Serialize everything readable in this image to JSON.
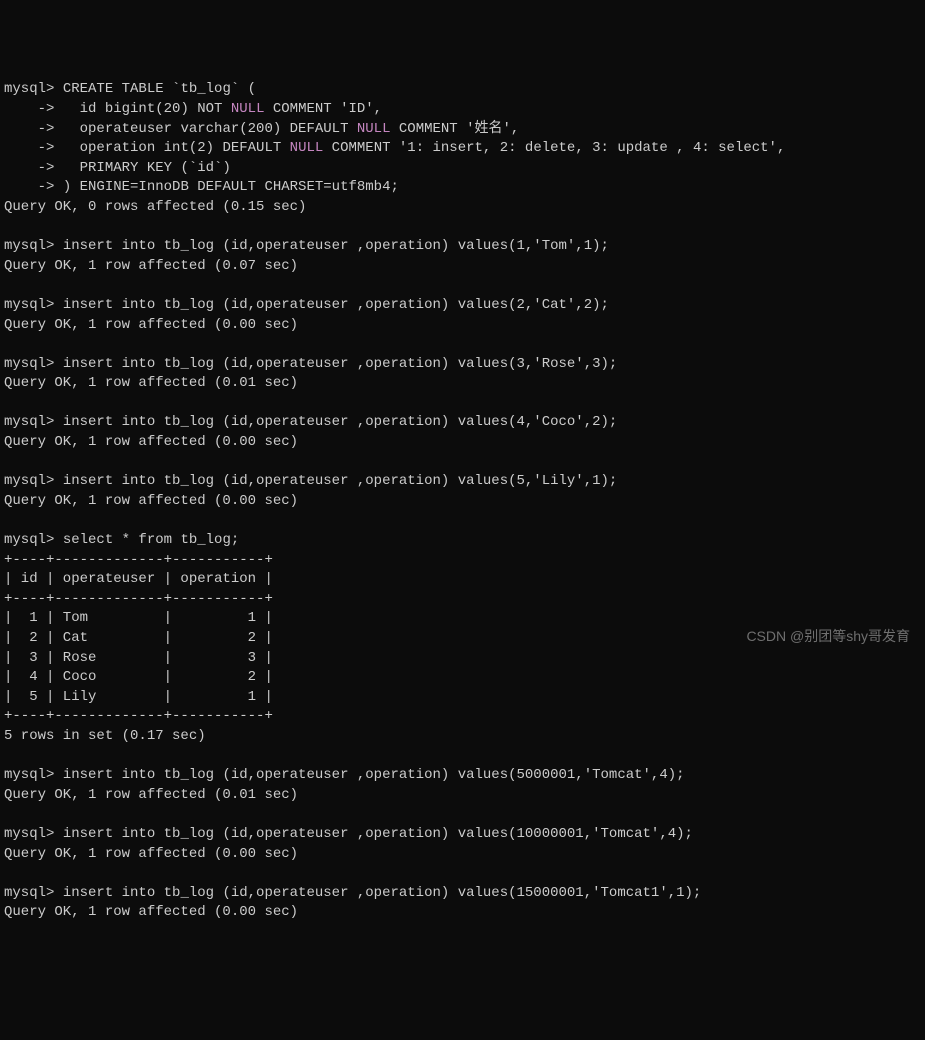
{
  "lines": [
    {
      "prompt": "mysql>",
      "text": " CREATE TABLE `tb_log` ("
    },
    {
      "prompt": "    ->",
      "text": "   id bigint(20) NOT ",
      "null": "NULL",
      "after": " COMMENT 'ID',"
    },
    {
      "prompt": "    ->",
      "text": "   operateuser varchar(200) DEFAULT ",
      "null": "NULL",
      "after": " COMMENT '姓名',"
    },
    {
      "prompt": "    ->",
      "text": "   operation int(2) DEFAULT ",
      "null": "NULL",
      "after": " COMMENT '1: insert, 2: delete, 3: update , 4: select',"
    },
    {
      "prompt": "    ->",
      "text": "   PRIMARY KEY (`id`)"
    },
    {
      "prompt": "    ->",
      "text": " ) ENGINE=InnoDB DEFAULT CHARSET=utf8mb4;"
    },
    {
      "text": "Query OK, 0 rows affected (0.15 sec)"
    },
    {
      "text": ""
    },
    {
      "prompt": "mysql>",
      "text": " insert into tb_log (id,operateuser ,operation) values(1,'Tom',1);"
    },
    {
      "text": "Query OK, 1 row affected (0.07 sec)"
    },
    {
      "text": ""
    },
    {
      "prompt": "mysql>",
      "text": " insert into tb_log (id,operateuser ,operation) values(2,'Cat',2);"
    },
    {
      "text": "Query OK, 1 row affected (0.00 sec)"
    },
    {
      "text": ""
    },
    {
      "prompt": "mysql>",
      "text": " insert into tb_log (id,operateuser ,operation) values(3,'Rose',3);"
    },
    {
      "text": "Query OK, 1 row affected (0.01 sec)"
    },
    {
      "text": ""
    },
    {
      "prompt": "mysql>",
      "text": " insert into tb_log (id,operateuser ,operation) values(4,'Coco',2);"
    },
    {
      "text": "Query OK, 1 row affected (0.00 sec)"
    },
    {
      "text": ""
    },
    {
      "prompt": "mysql>",
      "text": " insert into tb_log (id,operateuser ,operation) values(5,'Lily',1);"
    },
    {
      "text": "Query OK, 1 row affected (0.00 sec)"
    },
    {
      "text": ""
    },
    {
      "prompt": "mysql>",
      "text": " select * from tb_log;"
    },
    {
      "text": "+----+-------------+-----------+"
    },
    {
      "text": "| id | operateuser | operation |"
    },
    {
      "text": "+----+-------------+-----------+"
    },
    {
      "text": "|  1 | Tom         |         1 |"
    },
    {
      "text": "|  2 | Cat         |         2 |"
    },
    {
      "text": "|  3 | Rose        |         3 |"
    },
    {
      "text": "|  4 | Coco        |         2 |"
    },
    {
      "text": "|  5 | Lily        |         1 |"
    },
    {
      "text": "+----+-------------+-----------+"
    },
    {
      "text": "5 rows in set (0.17 sec)"
    },
    {
      "text": ""
    },
    {
      "prompt": "mysql>",
      "text": " insert into tb_log (id,operateuser ,operation) values(5000001,'Tomcat',4);"
    },
    {
      "text": "Query OK, 1 row affected (0.01 sec)"
    },
    {
      "text": ""
    },
    {
      "prompt": "mysql>",
      "text": " insert into tb_log (id,operateuser ,operation) values(10000001,'Tomcat',4);"
    },
    {
      "text": "Query OK, 1 row affected (0.00 sec)"
    },
    {
      "text": ""
    },
    {
      "prompt": "mysql>",
      "text": " insert into tb_log (id,operateuser ,operation) values(15000001,'Tomcat1',1);"
    },
    {
      "text": "Query OK, 1 row affected (0.00 sec)"
    }
  ],
  "watermark": "CSDN @别团等shy哥发育"
}
